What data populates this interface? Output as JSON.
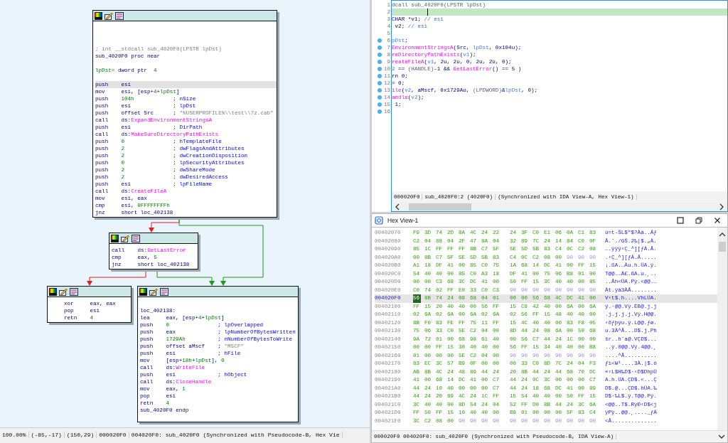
{
  "graph": {
    "nodes": [
      {
        "lines": [
          {
            "kind": "blank"
          },
          {
            "kind": "blank"
          },
          {
            "kind": "blank"
          },
          {
            "kind": "text",
            "segments": [
              {
                "text": "; int __stdcall sub_4020F0(LPSTR lpDst)",
                "kind": "muted"
              }
            ]
          },
          {
            "kind": "text",
            "segments": [
              {
                "text": "sub_4020F0 proc near",
                "kind": "plain"
              }
            ]
          },
          {
            "kind": "blank"
          },
          {
            "kind": "text",
            "segments": [
              {
                "text": "lpDst=",
                "kind": "num"
              },
              {
                "text": " dword ptr  ",
                "kind": "plain"
              },
              {
                "text": "4",
                "kind": "num"
              }
            ]
          },
          {
            "kind": "blank"
          },
          {
            "kind": "instruction",
            "selected": true,
            "mnemonic": "push",
            "operand": [
              {
                "text": "esi",
                "kind": "plain"
              }
            ]
          },
          {
            "kind": "instruction",
            "selected": false,
            "mnemonic": "mov",
            "operand": [
              {
                "text": "esi, [esp+",
                "kind": "plain"
              },
              {
                "text": "4",
                "kind": "num"
              },
              {
                "text": "+",
                "kind": "plain"
              },
              {
                "text": "lpDst",
                "kind": "num"
              },
              {
                "text": "]",
                "kind": "plain"
              }
            ]
          },
          {
            "kind": "instruction",
            "selected": false,
            "mnemonic": "push",
            "operand": [
              {
                "text": "104h",
                "kind": "num"
              }
            ],
            "comment": [
              {
                "text": "; nSize",
                "kind": "comment"
              }
            ]
          },
          {
            "kind": "instruction",
            "selected": false,
            "mnemonic": "push",
            "operand": [
              {
                "text": "esi",
                "kind": "plain"
              }
            ],
            "comment": [
              {
                "text": "; lpDst",
                "kind": "comment"
              }
            ]
          },
          {
            "kind": "instruction",
            "selected": false,
            "mnemonic": "push",
            "operand": [
              {
                "text": "offset Src",
                "kind": "plain"
              }
            ],
            "comment": [
              {
                "text": "; ",
                "kind": "comment"
              },
              {
                "text": "\"%USERPROFILE%\\\\test\\\\7z.cab\"",
                "kind": "string"
              }
            ]
          },
          {
            "kind": "instruction",
            "selected": false,
            "mnemonic": "call",
            "operand": [
              {
                "text": "ds:",
                "kind": "plain"
              },
              {
                "text": "ExpandEnvironmentStringsA",
                "kind": "api"
              }
            ]
          },
          {
            "kind": "instruction",
            "selected": false,
            "mnemonic": "push",
            "operand": [
              {
                "text": "esi",
                "kind": "plain"
              }
            ],
            "comment": [
              {
                "text": "; DirPath",
                "kind": "comment"
              }
            ]
          },
          {
            "kind": "instruction",
            "selected": false,
            "mnemonic": "call",
            "operand": [
              {
                "text": "ds:",
                "kind": "plain"
              },
              {
                "text": "MakeSureDirectoryPathExists",
                "kind": "api"
              }
            ]
          },
          {
            "kind": "instruction",
            "selected": false,
            "mnemonic": "push",
            "operand": [
              {
                "text": "0",
                "kind": "num"
              }
            ],
            "comment": [
              {
                "text": "; hTemplateFile",
                "kind": "comment"
              }
            ]
          },
          {
            "kind": "instruction",
            "selected": false,
            "mnemonic": "push",
            "operand": [
              {
                "text": "2",
                "kind": "num"
              }
            ],
            "comment": [
              {
                "text": "; dwFlagsAndAttributes",
                "kind": "comment"
              }
            ]
          },
          {
            "kind": "instruction",
            "selected": false,
            "mnemonic": "push",
            "operand": [
              {
                "text": "2",
                "kind": "num"
              }
            ],
            "comment": [
              {
                "text": "; dwCreationDisposition",
                "kind": "comment"
              }
            ]
          },
          {
            "kind": "instruction",
            "selected": false,
            "mnemonic": "push",
            "operand": [
              {
                "text": "0",
                "kind": "num"
              }
            ],
            "comment": [
              {
                "text": "; lpSecurityAttributes",
                "kind": "comment"
              }
            ]
          },
          {
            "kind": "instruction",
            "selected": false,
            "mnemonic": "push",
            "operand": [
              {
                "text": "2",
                "kind": "num"
              }
            ],
            "comment": [
              {
                "text": "; dwShareMode",
                "kind": "comment"
              }
            ]
          },
          {
            "kind": "instruction",
            "selected": false,
            "mnemonic": "push",
            "operand": [
              {
                "text": "2",
                "kind": "num"
              }
            ],
            "comment": [
              {
                "text": "; dwDesiredAccess",
                "kind": "comment"
              }
            ]
          },
          {
            "kind": "instruction",
            "selected": false,
            "mnemonic": "push",
            "operand": [
              {
                "text": "esi",
                "kind": "plain"
              }
            ],
            "comment": [
              {
                "text": "; lpFileName",
                "kind": "comment"
              }
            ]
          },
          {
            "kind": "instruction",
            "selected": false,
            "mnemonic": "call",
            "operand": [
              {
                "text": "ds:",
                "kind": "plain"
              },
              {
                "text": "CreateFileA",
                "kind": "api"
              }
            ]
          },
          {
            "kind": "instruction",
            "selected": false,
            "mnemonic": "mov",
            "operand": [
              {
                "text": "esi, eax",
                "kind": "plain"
              }
            ]
          },
          {
            "kind": "instruction",
            "selected": false,
            "mnemonic": "cmp",
            "operand": [
              {
                "text": "esi, ",
                "kind": "plain"
              },
              {
                "text": "0FFFFFFFFh",
                "kind": "num"
              }
            ]
          },
          {
            "kind": "instruction",
            "selected": false,
            "mnemonic": "jnz",
            "operand": [
              {
                "text": "short loc_402138",
                "kind": "plain"
              }
            ]
          }
        ]
      },
      {
        "lines": [
          {
            "kind": "instruction",
            "selected": false,
            "mnemonic": "call",
            "operand": [
              {
                "text": "ds:",
                "kind": "plain"
              },
              {
                "text": "GetLastError",
                "kind": "api"
              }
            ]
          },
          {
            "kind": "instruction",
            "selected": false,
            "mnemonic": "cmp",
            "operand": [
              {
                "text": "eax, ",
                "kind": "plain"
              },
              {
                "text": "5",
                "kind": "num"
              }
            ]
          },
          {
            "kind": "instruction",
            "selected": false,
            "mnemonic": "jnz",
            "operand": [
              {
                "text": "short loc_402138",
                "kind": "plain"
              }
            ]
          }
        ]
      },
      {
        "lines": [
          {
            "kind": "instruction",
            "selected": false,
            "mnemonic": "xor",
            "operand": [
              {
                "text": "eax, eax",
                "kind": "plain"
              }
            ]
          },
          {
            "kind": "instruction",
            "selected": false,
            "mnemonic": "pop",
            "operand": [
              {
                "text": "esi",
                "kind": "plain"
              }
            ]
          },
          {
            "kind": "instruction",
            "selected": false,
            "mnemonic": "retn",
            "operand": [
              {
                "text": "4",
                "kind": "num"
              }
            ]
          }
        ]
      },
      {
        "lines": [
          {
            "kind": "blank"
          },
          {
            "kind": "text",
            "segments": [
              {
                "text": "loc_402138:",
                "kind": "plain"
              }
            ]
          },
          {
            "kind": "instruction",
            "selected": false,
            "mnemonic": "lea",
            "operand": [
              {
                "text": "eax, [esp+",
                "kind": "plain"
              },
              {
                "text": "4",
                "kind": "num"
              },
              {
                "text": "+",
                "kind": "plain"
              },
              {
                "text": "lpDst",
                "kind": "num"
              },
              {
                "text": "]",
                "kind": "plain"
              }
            ]
          },
          {
            "kind": "instruction",
            "selected": false,
            "mnemonic": "push",
            "operand": [
              {
                "text": "0",
                "kind": "num"
              }
            ],
            "comment": [
              {
                "text": "; lpOverlapped",
                "kind": "comment"
              }
            ]
          },
          {
            "kind": "instruction",
            "selected": false,
            "mnemonic": "push",
            "operand": [
              {
                "text": "eax",
                "kind": "plain"
              }
            ],
            "comment": [
              {
                "text": "; lpNumberOfBytesWritten",
                "kind": "comment"
              }
            ]
          },
          {
            "kind": "instruction",
            "selected": false,
            "mnemonic": "push",
            "operand": [
              {
                "text": "1729Ah",
                "kind": "num"
              }
            ],
            "comment": [
              {
                "text": "; nNumberOfBytesToWrite",
                "kind": "comment"
              }
            ]
          },
          {
            "kind": "instruction",
            "selected": false,
            "mnemonic": "push",
            "operand": [
              {
                "text": "offset aMscf",
                "kind": "plain"
              }
            ],
            "comment": [
              {
                "text": "; ",
                "kind": "comment"
              },
              {
                "text": "\"MSCF\"",
                "kind": "string"
              }
            ]
          },
          {
            "kind": "instruction",
            "selected": false,
            "mnemonic": "push",
            "operand": [
              {
                "text": "esi",
                "kind": "plain"
              }
            ],
            "comment": [
              {
                "text": "; hFile",
                "kind": "comment"
              }
            ]
          },
          {
            "kind": "instruction",
            "selected": false,
            "mnemonic": "mov",
            "operand": [
              {
                "text": "[esp+",
                "kind": "plain"
              },
              {
                "text": "18h",
                "kind": "num"
              },
              {
                "text": "+",
                "kind": "plain"
              },
              {
                "text": "lpDst",
                "kind": "num"
              },
              {
                "text": "], ",
                "kind": "plain"
              },
              {
                "text": "0",
                "kind": "num"
              }
            ]
          },
          {
            "kind": "instruction",
            "selected": false,
            "mnemonic": "call",
            "operand": [
              {
                "text": "ds:",
                "kind": "plain"
              },
              {
                "text": "WriteFile",
                "kind": "api"
              }
            ]
          },
          {
            "kind": "instruction",
            "selected": false,
            "mnemonic": "push",
            "operand": [
              {
                "text": "esi",
                "kind": "plain"
              }
            ],
            "comment": [
              {
                "text": "; hObject",
                "kind": "comment"
              }
            ]
          },
          {
            "kind": "instruction",
            "selected": false,
            "mnemonic": "call",
            "operand": [
              {
                "text": "ds:",
                "kind": "plain"
              },
              {
                "text": "CloseHandle",
                "kind": "api"
              }
            ]
          },
          {
            "kind": "instruction",
            "selected": false,
            "mnemonic": "mov",
            "operand": [
              {
                "text": "eax, ",
                "kind": "plain"
              },
              {
                "text": "1",
                "kind": "num"
              }
            ]
          },
          {
            "kind": "instruction",
            "selected": false,
            "mnemonic": "pop",
            "operand": [
              {
                "text": "esi",
                "kind": "plain"
              }
            ]
          },
          {
            "kind": "instruction",
            "selected": false,
            "mnemonic": "retn",
            "operand": [
              {
                "text": "4",
                "kind": "num"
              }
            ]
          },
          {
            "kind": "text",
            "segments": [
              {
                "text": "sub_4020F0 endp",
                "kind": "plain"
              }
            ]
          },
          {
            "kind": "blank"
          }
        ]
      }
    ],
    "status_bar": [
      "100.00%",
      "(-85,-17)",
      "(150,29)",
      "000020F0",
      "004020F0: sub_4020F0 (Synchronized with Pseudocode-B, Hex Vie"
    ]
  },
  "pseudocode": {
    "lines": [
      {
        "number": "1",
        "dot": false,
        "current": false,
        "segments": [
          {
            "text": "dcall sub_4020F0(LPSTR lpDst)",
            "kind": "type"
          }
        ]
      },
      {
        "number": "2",
        "dot": false,
        "current": true
      },
      {
        "number": "3",
        "dot": false,
        "current": false,
        "segments": [
          {
            "text": "CHAR *v1; ",
            "kind": "plain"
          },
          {
            "text": "// esi",
            "kind": "comment"
          }
        ]
      },
      {
        "number": "4",
        "dot": false,
        "current": false,
        "segments": [
          {
            "text": " v2; ",
            "kind": "plain"
          },
          {
            "text": "// esi",
            "kind": "comment"
          }
        ]
      },
      {
        "number": "5",
        "dot": false,
        "current": false
      },
      {
        "number": "6",
        "dot": true,
        "current": false,
        "segments": [
          {
            "text": "pDst",
            "kind": "var"
          },
          {
            "text": ";",
            "kind": "plain"
          }
        ]
      },
      {
        "number": "7",
        "dot": true,
        "current": false,
        "segments": [
          {
            "text": "EnvironmentStringsA",
            "kind": "api"
          },
          {
            "text": "(Src, ",
            "kind": "plain"
          },
          {
            "text": "lpDst",
            "kind": "var"
          },
          {
            "text": ", 0x104u);",
            "kind": "plain"
          }
        ]
      },
      {
        "number": "8",
        "dot": true,
        "current": false,
        "segments": [
          {
            "text": "reDirectoryPathExists",
            "kind": "api"
          },
          {
            "text": "(",
            "kind": "plain"
          },
          {
            "text": "v1",
            "kind": "var"
          },
          {
            "text": ");",
            "kind": "plain"
          }
        ]
      },
      {
        "number": "9",
        "dot": true,
        "current": false,
        "segments": [
          {
            "text": "reateFileA",
            "kind": "api"
          },
          {
            "text": "(",
            "kind": "plain"
          },
          {
            "text": "v1",
            "kind": "var"
          },
          {
            "text": ", 2u, 2u, 0, 2u, 2u, 0);",
            "kind": "plain"
          }
        ]
      },
      {
        "number": "10",
        "dot": true,
        "current": false,
        "segments": [
          {
            "text": "2",
            "kind": "var"
          },
          {
            "text": " == ",
            "kind": "plain"
          },
          {
            "text": "(HANDLE)",
            "kind": "type"
          },
          {
            "text": "-1 && ",
            "kind": "plain"
          },
          {
            "text": "GetLastError",
            "kind": "api"
          },
          {
            "text": "() == 5 )",
            "kind": "plain"
          }
        ]
      },
      {
        "number": "11",
        "dot": true,
        "current": false,
        "segments": [
          {
            "text": "rn 0;",
            "kind": "plain"
          }
        ]
      },
      {
        "number": "12",
        "dot": true,
        "current": false,
        "segments": [
          {
            "text": "= 0;",
            "kind": "plain"
          }
        ]
      },
      {
        "number": "13",
        "dot": true,
        "current": false,
        "segments": [
          {
            "text": "ile",
            "kind": "api"
          },
          {
            "text": "(",
            "kind": "plain"
          },
          {
            "text": "v2",
            "kind": "var"
          },
          {
            "text": ", aMscf, 0x1729Au, ",
            "kind": "plain"
          },
          {
            "text": "(LPDWORD)",
            "kind": "type"
          },
          {
            "text": "&",
            "kind": "plain"
          },
          {
            "text": "lpDst",
            "kind": "var"
          },
          {
            "text": ", 0);",
            "kind": "plain"
          }
        ]
      },
      {
        "number": "14",
        "dot": true,
        "current": false,
        "segments": [
          {
            "text": "andle",
            "kind": "api"
          },
          {
            "text": "(",
            "kind": "plain"
          },
          {
            "text": "v2",
            "kind": "var"
          },
          {
            "text": ");",
            "kind": "plain"
          }
        ]
      },
      {
        "number": "15",
        "dot": true,
        "current": false,
        "segments": [
          {
            "text": " 1;",
            "kind": "plain"
          }
        ]
      },
      {
        "number": "16",
        "dot": true,
        "current": false
      }
    ],
    "status_bar": [
      "000020F0",
      "sub_4020F0:2 (4020F0)",
      "(Synchronized with IDA View-A, Hex View-1)"
    ]
  },
  "hex_view": {
    "title": "Hex View-1",
    "rows": [
      {
        "address": "00402070",
        "selected": false,
        "bytes": "F9 3D 74 2D 8A 4C 24 22 24 3F C0 E1 06 0A C1 83",
        "ascii": "ù=t-ŠL$\"$?Àá..Áƒ"
      },
      {
        "address": "00402080",
        "selected": false,
        "bytes": "C2 04 88 04 2F 47 8A 04 32 89 7C 24 14 84 C0 0F",
        "ascii": "Â.ˆ./GŠ.2‰|$.„À."
      },
      {
        "address": "00402090",
        "selected": false,
        "bytes": "85 1C FF FF FF 8B C7 5F 5E 5D 5B 83 C4 0C C2 08",
        "ascii": "….ÿÿÿ‹Ç_^][ƒÄ.Â."
      },
      {
        "address": "004020A0",
        "selected": false,
        "bytes": "00 8B C7 5F 5E 5D 5B 83 C4 0C C2 08 00",
        "padding": "90 90 90",
        "ascii": ".‹Ç_^][ƒÄ.Â....."
      },
      {
        "address": "004020B0",
        "selected": false,
        "bytes": "A1 18 DF 41 00 85 C0 75 1A 68 14 DC 41 00 FF 15",
        "ascii": "¡.ßA.…Àu.h.ÜA.ÿ."
      },
      {
        "address": "004020C0",
        "selected": false,
        "bytes": "54 40 40 00 85 C0 A3 18 DF 41 00 75 06 B8 01 00",
        "ascii": "T@@.…À£.ßA.u.¸.."
      },
      {
        "address": "004020D0",
        "selected": false,
        "bytes": "00 00 C3 68 3C DC 41 00 50 FF 15 3C 40 40 00 85",
        "ascii": "..Ãh<ÜA.Pÿ.<@@.…"
      },
      {
        "address": "004020E0",
        "selected": false,
        "bytes": "C0 74 02 FF E0 33 C0 C3",
        "padding": "90 90 90 90 90 90 90 90",
        "ascii": "Àt.ÿà3ÀÃ........"
      },
      {
        "address": "004020F0",
        "selected": true,
        "bytes": "56 8B 74 24 08 68 04 01 00 00 56 68 4C DC 41 00",
        "ascii": "V‹t$.h....VhLÜA."
      },
      {
        "address": "00402100",
        "selected": false,
        "bytes": "FF 15 20 40 40 00 56 FF 15 C8 42 40 00 6A 00 6A",
        "ascii": "ÿ.·@@.Vÿ.ÈB@.j.j"
      },
      {
        "address": "00402110",
        "selected": false,
        "bytes": "02 6A 02 6A 00 6A 02 6A 02 56 FF 15 48 40 40 00",
        "ascii": ".j.j.j.j.Vÿ.H@@."
      },
      {
        "address": "00402120",
        "selected": false,
        "bytes": "8B F0 83 FE FF 75 11 FF 15 4C 40 40 00 83 F8 05",
        "ascii": "‹ðƒþÿu.ÿ.L@@.ƒø."
      },
      {
        "address": "00402130",
        "selected": false,
        "bytes": "75 06 33 C0 5E C2 04 00 8D 44 24 08 6A 00 50 68",
        "ascii": "u.3À^Â...D$.j.Ph"
      },
      {
        "address": "00402140",
        "selected": false,
        "bytes": "9A 72 01 00 68 98 61 40 00 56 C7 44 24 1C 00 00",
        "ascii": "šr..h˜a@.VÇD$..."
      },
      {
        "address": "00402150",
        "selected": false,
        "bytes": "00 00 FF 15 30 40 40 00 56 FF 15 34 40 40 00 B8",
        "ascii": "..ÿ.0@@.Vÿ.4@@.¸"
      },
      {
        "address": "00402160",
        "selected": false,
        "bytes": "01 00 00 00 5E C2 04 00",
        "padding": "90 90 90 90 90 90 90 90",
        "ascii": "....^Â.........."
      },
      {
        "address": "00402170",
        "selected": false,
        "bytes": "83 EC 3C 57 B9 0F 00 00 00 33 C0 8D 7C 24 04 F3",
        "ascii": "ƒì<W¹....3À.|$.ó"
      },
      {
        "address": "00402180",
        "selected": false,
        "bytes": "AB 8B 4C 24 48 89 44 24 20 8B 44 24 44 68 70 DC",
        "ascii": "«‹L$H‰D$·‹D$DhpÜ"
      },
      {
        "address": "00402190",
        "selected": false,
        "bytes": "41 00 68 14 DC 41 00 C7 44 24 0C 3C 00 00 00 C7",
        "ascii": "A.h.ÜA.ÇD$.<...Ç"
      },
      {
        "address": "004021A0",
        "selected": false,
        "bytes": "44 24 10 40 00 00 00 C7 44 24 18 68 DC 41 00 89",
        "ascii": "D$.@...ÇD$.hÜA.‰"
      },
      {
        "address": "004021B0",
        "selected": false,
        "bytes": "44 24 20 89 4C 24 1C FF 15 54 40 40 00 50 FF 15",
        "ascii": "D$·‰L$.ÿ.T@@.Pÿ."
      },
      {
        "address": "004021C0",
        "selected": false,
        "bytes": "3C 40 40 00 8D 54 24 04 52 FF D0 8B 44 24 3C 6A",
        "ascii": "<@@..T$.RÿÐ‹D$<j"
      },
      {
        "address": "004021D0",
        "selected": false,
        "bytes": "FF 50 FF 15 10 40 40 00 B8 01 00 00 00 5F 83 C4",
        "ascii": "ÿPÿ..@@.¸...._ƒÄ"
      },
      {
        "address": "004021E0",
        "selected": false,
        "bytes": "3C C2 08 00",
        "padding": "90 90 90 90 90 90 90 90 90 90 90 90",
        "ascii": "<Â.............."
      }
    ],
    "status_bar": "000020F0 004020F0: sub_4020F0 (Synchronized with Pseudocode-B, IDA View-A)"
  }
}
